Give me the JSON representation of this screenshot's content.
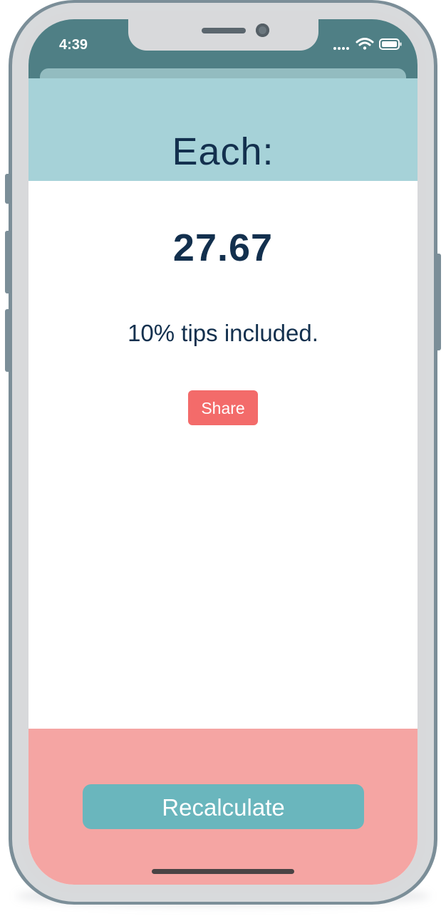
{
  "status_bar": {
    "time": "4:39",
    "icons": [
      "cellular-dots-icon",
      "wifi-icon",
      "battery-icon"
    ]
  },
  "header": {
    "title": "Each:"
  },
  "result": {
    "amount": "27.67",
    "note": "10% tips included.",
    "share_label": "Share"
  },
  "footer": {
    "recalculate_label": "Recalculate"
  },
  "colors": {
    "status_bar": "#4f7f85",
    "header_bg": "#a6d2d8",
    "text_primary": "#13304e",
    "share_button": "#f36b6a",
    "footer_bg": "#f5a5a3",
    "recalculate_button": "#6ab6bd"
  }
}
